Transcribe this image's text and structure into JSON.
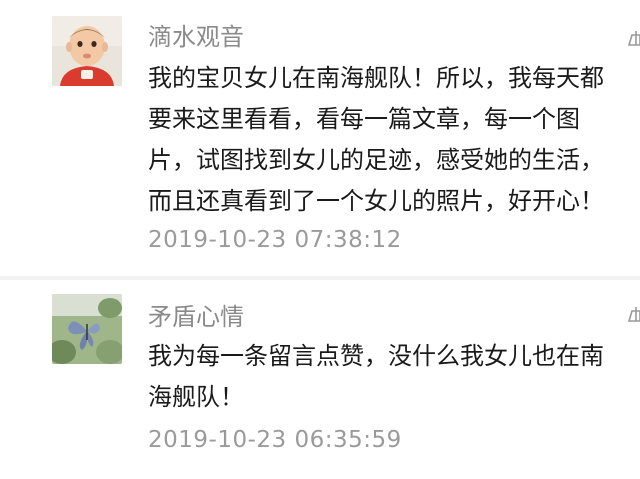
{
  "comments": [
    {
      "nickname": "滴水观音",
      "content_lines": [
        "我的宝贝女儿在南海舰队！所以，我每天都",
        "要来这里看看，看每一篇文章，每一个图",
        "片，试图找到女儿的足迹，感受她的生活，",
        "而且还真看到了一个女儿的照片，好开心！"
      ],
      "timestamp": "2019-10-23 07:38:12",
      "avatar_icon": "baby-photo-avatar",
      "like_icon": "thumbs-up-icon"
    },
    {
      "nickname": "矛盾心情",
      "content_lines": [
        "我为每一条留言点赞，没什么我女儿也在南",
        "海舰队！"
      ],
      "timestamp": "2019-10-23 06:35:59",
      "avatar_icon": "butterfly-photo-avatar",
      "like_icon": "thumbs-up-icon"
    }
  ],
  "colors": {
    "nickname": "#8a8a8a",
    "content": "#1a1a1a",
    "timestamp": "#9a9a9a",
    "divider": "#f2f2f2"
  }
}
